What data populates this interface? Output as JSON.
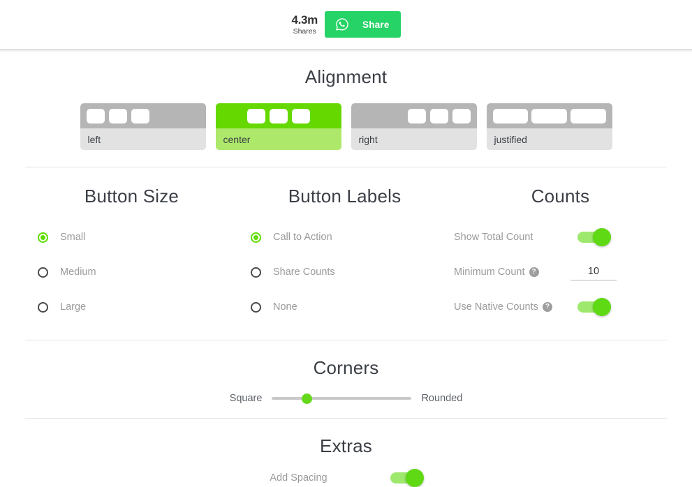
{
  "preview": {
    "count_value": "4.3m",
    "count_label": "Shares",
    "share_cta": "Share",
    "icon": "whatsapp-icon",
    "brand_color": "#25d366"
  },
  "alignment": {
    "title": "Alignment",
    "selected": "center",
    "accent_color": "#65d800",
    "options": [
      {
        "key": "left",
        "label": "left"
      },
      {
        "key": "center",
        "label": "center"
      },
      {
        "key": "right",
        "label": "right"
      },
      {
        "key": "justified",
        "label": "justified"
      }
    ]
  },
  "button_size": {
    "title": "Button Size",
    "selected": "Small",
    "options": [
      {
        "label": "Small",
        "selected": true
      },
      {
        "label": "Medium",
        "selected": false
      },
      {
        "label": "Large",
        "selected": false
      }
    ]
  },
  "button_labels": {
    "title": "Button Labels",
    "selected": "Call to Action",
    "options": [
      {
        "label": "Call to Action",
        "selected": true
      },
      {
        "label": "Share Counts",
        "selected": false
      },
      {
        "label": "None",
        "selected": false
      }
    ]
  },
  "counts": {
    "title": "Counts",
    "show_total_count": {
      "label": "Show Total Count",
      "on": true
    },
    "minimum_count": {
      "label": "Minimum Count",
      "value": "10",
      "help_icon": "question-mark-icon"
    },
    "use_native_counts": {
      "label": "Use Native Counts",
      "on": true,
      "help_icon": "question-mark-icon"
    }
  },
  "corners": {
    "title": "Corners",
    "min_label": "Square",
    "max_label": "Rounded",
    "value_percent": 25
  },
  "extras": {
    "title": "Extras",
    "add_spacing": {
      "label": "Add Spacing",
      "on": true
    }
  },
  "theme": {
    "toggle_track": "#9fe86e",
    "toggle_knob": "#5fd914",
    "radio_on": "#5fdd00",
    "slider_knob": "#66d81b"
  }
}
